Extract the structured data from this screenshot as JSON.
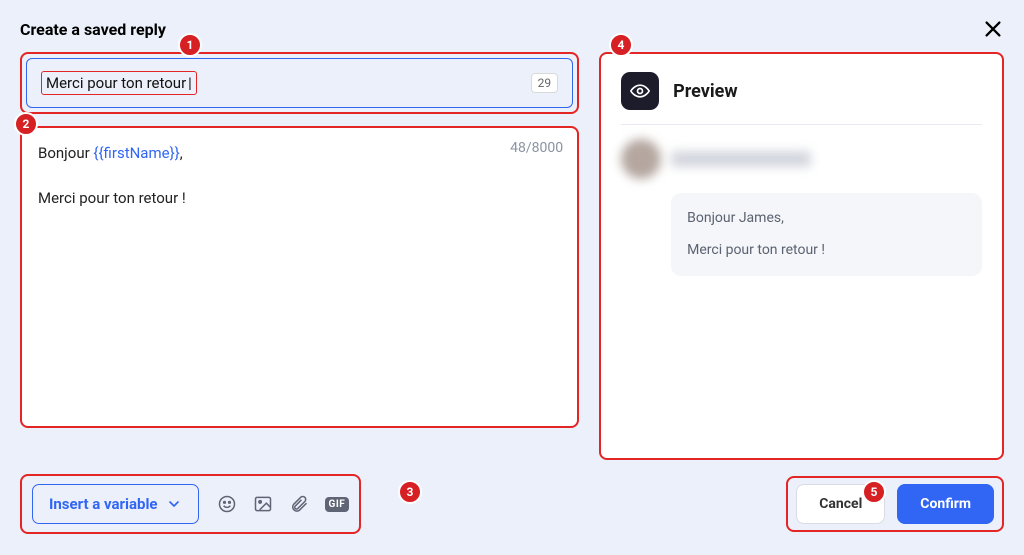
{
  "header": {
    "title": "Create a saved reply"
  },
  "name_input": {
    "value": "Merci pour ton retour",
    "remaining": "29"
  },
  "editor": {
    "counter": "48/8000",
    "line1_prefix": "Bonjour ",
    "line1_variable": "{{firstName}}",
    "line1_suffix": ",",
    "line2": "Merci pour ton retour !"
  },
  "preview": {
    "title": "Preview",
    "message_line1": "Bonjour James,",
    "message_line2": "Merci pour ton retour !"
  },
  "toolbar": {
    "insert_variable_label": "Insert a variable",
    "gif_label": "GIF"
  },
  "actions": {
    "cancel_label": "Cancel",
    "confirm_label": "Confirm"
  },
  "callouts": {
    "c1": "1",
    "c2": "2",
    "c3": "3",
    "c4": "4",
    "c5": "5"
  }
}
